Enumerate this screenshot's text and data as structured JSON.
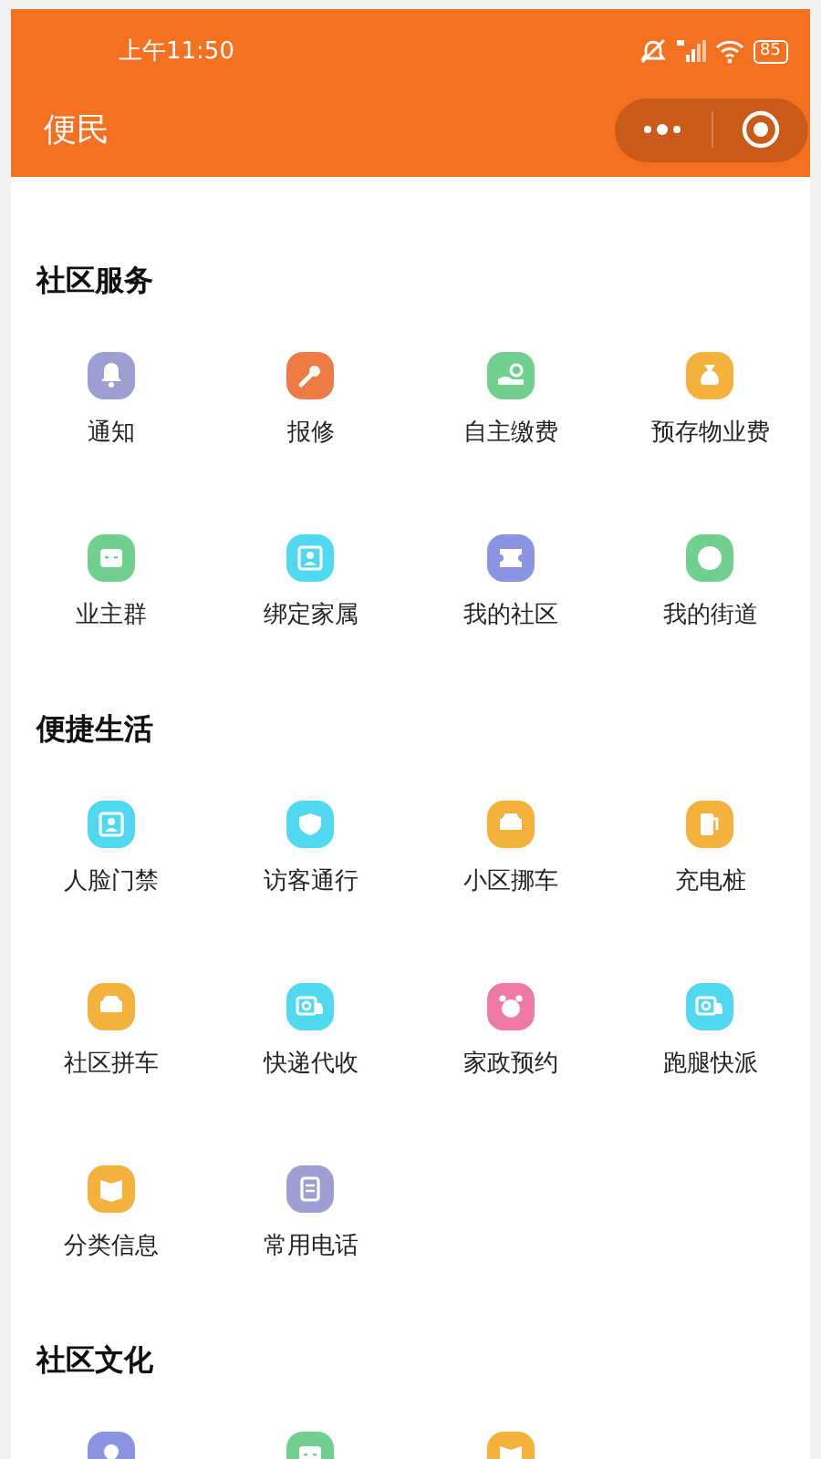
{
  "status_bar": {
    "time": "上午11:50",
    "battery": "85"
  },
  "nav_bar": {
    "title": "便民"
  },
  "sections": [
    {
      "title": "社区服务",
      "items": [
        {
          "label": "通知",
          "color": "#9d9fd3"
        },
        {
          "label": "报修",
          "color": "#ee7a45"
        },
        {
          "label": "自主缴费",
          "color": "#6fd08f"
        },
        {
          "label": "预存物业费",
          "color": "#f4b13c"
        },
        {
          "label": "业主群",
          "color": "#6fd08f"
        },
        {
          "label": "绑定家属",
          "color": "#4fd8f0"
        },
        {
          "label": "我的社区",
          "color": "#8b93e3"
        },
        {
          "label": "我的街道",
          "color": "#6fd08f"
        }
      ]
    },
    {
      "title": "便捷生活",
      "items": [
        {
          "label": "人脸门禁",
          "color": "#4fd8f0"
        },
        {
          "label": "访客通行",
          "color": "#4fd8f0"
        },
        {
          "label": "小区挪车",
          "color": "#f4b13c"
        },
        {
          "label": "充电桩",
          "color": "#f4b13c"
        },
        {
          "label": "社区拼车",
          "color": "#f4b13c"
        },
        {
          "label": "快递代收",
          "color": "#4fd8f0"
        },
        {
          "label": "家政预约",
          "color": "#f07aa6"
        },
        {
          "label": "跑腿快派",
          "color": "#4fd8f0"
        },
        {
          "label": "分类信息",
          "color": "#f4b13c"
        },
        {
          "label": "常用电话",
          "color": "#9d9fd3"
        }
      ]
    },
    {
      "title": "社区文化",
      "items": [
        {
          "color": "#8b93e3"
        },
        {
          "color": "#6fd08f"
        },
        {
          "color": "#f4b13c"
        }
      ]
    }
  ]
}
